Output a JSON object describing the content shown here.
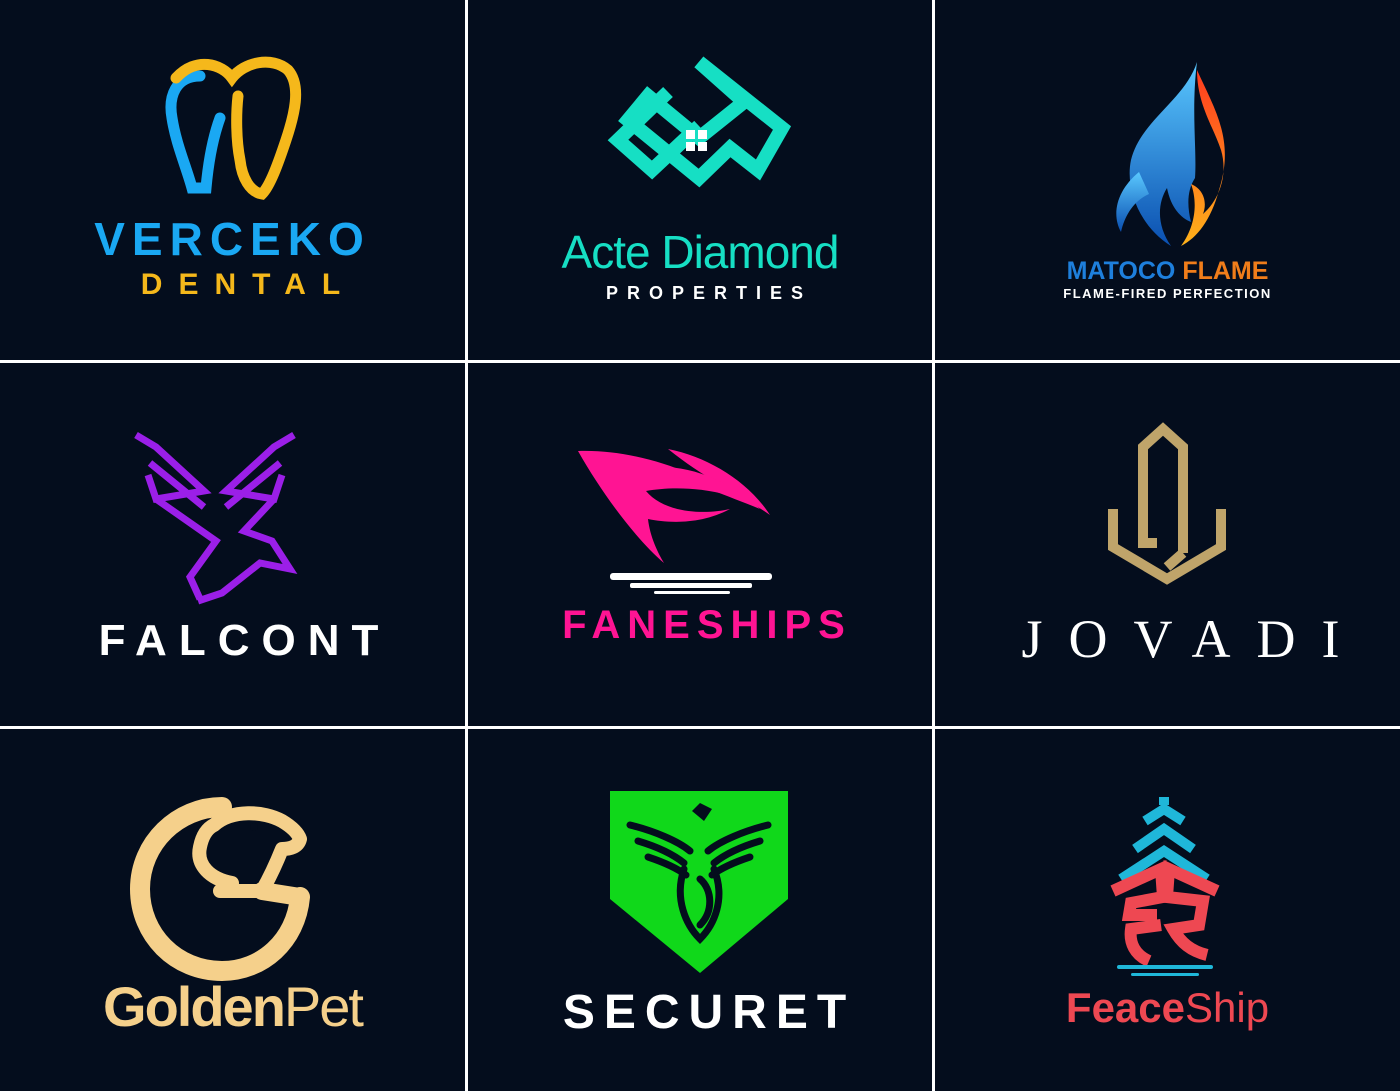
{
  "colors": {
    "background": "#040d1d",
    "grid_lines": "#ffffff"
  },
  "logos": [
    {
      "id": "verceko-dental",
      "icon": "tooth-icon",
      "name": "VERCEKO",
      "tagline": "DENTAL",
      "colors": [
        "#1aa8f3",
        "#f5b81b"
      ]
    },
    {
      "id": "acte-diamond",
      "icon": "house-diamond-icon",
      "name": "Acte Diamond",
      "tagline": "PROPERTIES",
      "colors": [
        "#16dfc4",
        "#ffffff"
      ]
    },
    {
      "id": "matoco-flame",
      "icon": "flame-icon",
      "name_part1": "MATOCO",
      "name_part2": "FLAME",
      "tagline": "FLAME-FIRED PERFECTION",
      "colors": [
        "#1e7fdc",
        "#f07d1a",
        "#ffffff"
      ]
    },
    {
      "id": "falcont",
      "icon": "falcon-icon",
      "name": "FALCONT",
      "colors": [
        "#9b1fe8",
        "#ffffff"
      ]
    },
    {
      "id": "faneships",
      "icon": "sail-ship-icon",
      "name": "FANESHIPS",
      "colors": [
        "#ff1493",
        "#ffffff"
      ]
    },
    {
      "id": "jovadi",
      "icon": "monogram-j-icon",
      "name": "JOVADI",
      "colors": [
        "#bfa46a",
        "#ffffff"
      ]
    },
    {
      "id": "goldenpet",
      "icon": "dog-g-icon",
      "name_part1": "Golden",
      "name_part2": "Pet",
      "colors": [
        "#f5d08b"
      ]
    },
    {
      "id": "securet",
      "icon": "eagle-shield-icon",
      "name": "SECURET",
      "colors": [
        "#10d81a",
        "#ffffff"
      ]
    },
    {
      "id": "feaceship",
      "icon": "ship-icon",
      "name_part1": "Feace",
      "name_part2": "Ship",
      "colors": [
        "#1fb7d9",
        "#ee4852"
      ]
    }
  ]
}
